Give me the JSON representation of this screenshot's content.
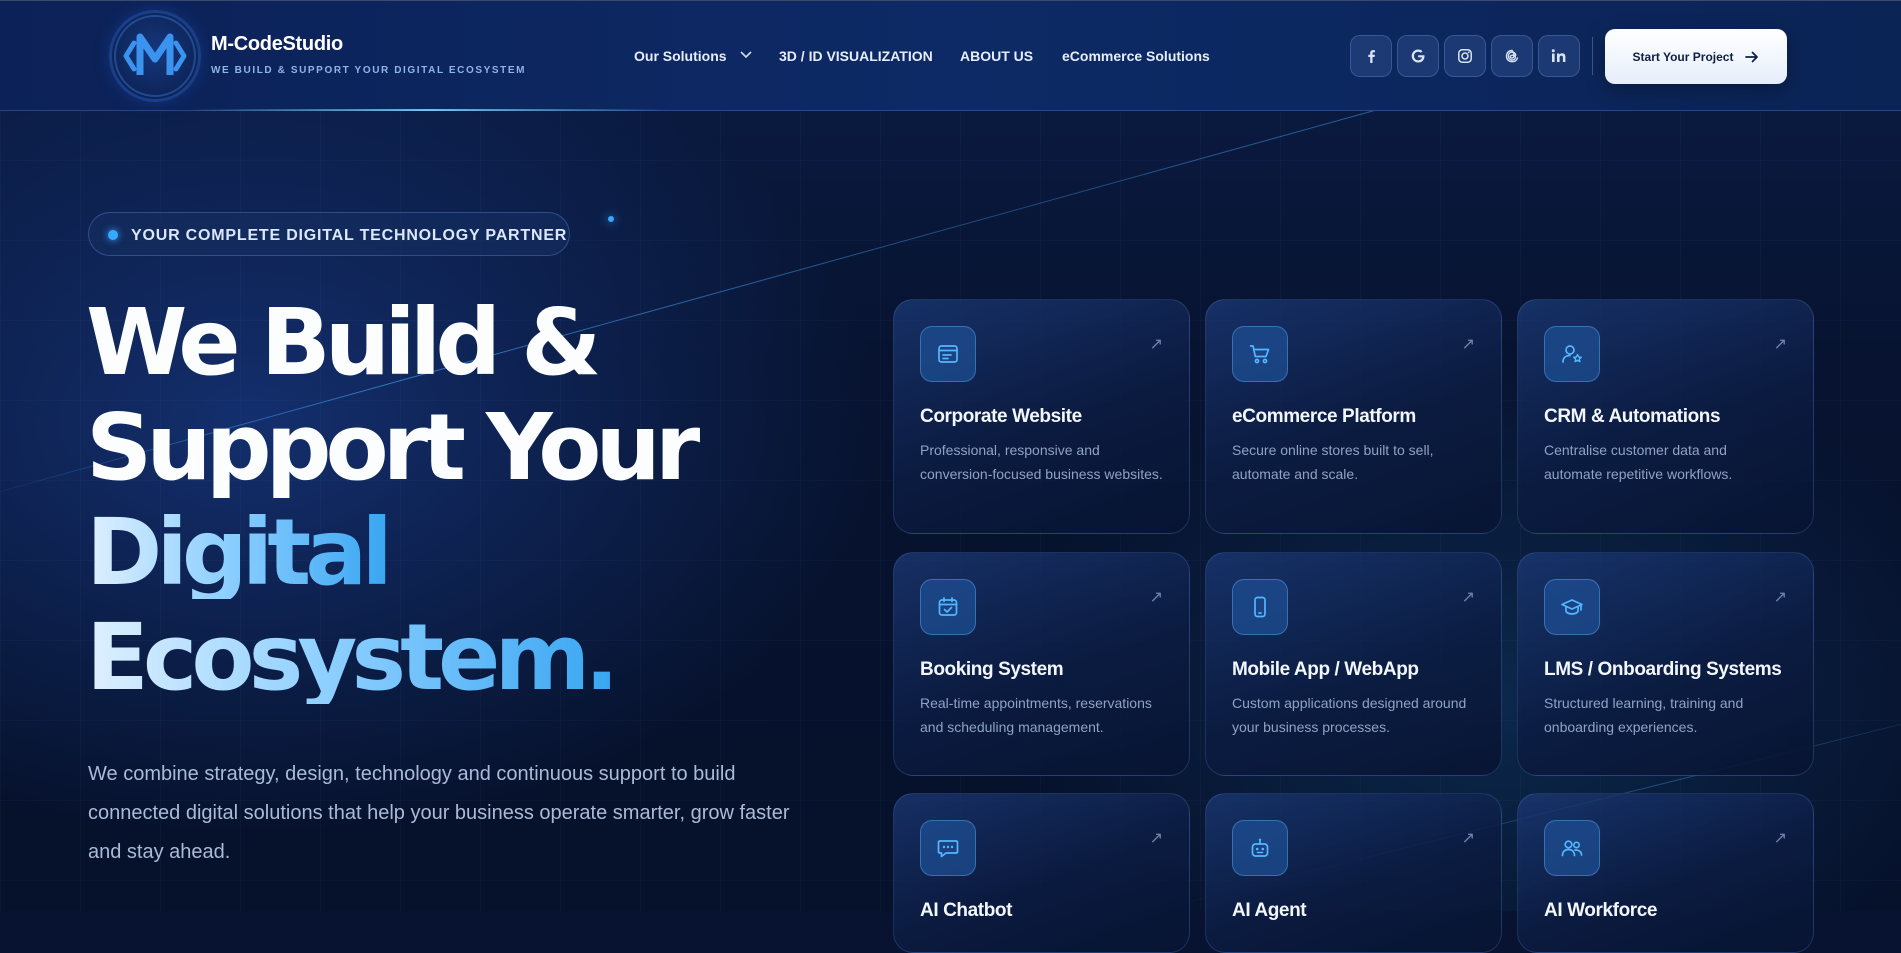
{
  "brand": {
    "name": "M-CodeStudio",
    "tagline": "WE BUILD & SUPPORT YOUR DIGITAL ECOSYSTEM"
  },
  "nav": {
    "items": [
      {
        "label": "Our Solutions",
        "has_dropdown": true
      },
      {
        "label": "3D / ID VISUALIZATION"
      },
      {
        "label": "ABOUT US"
      },
      {
        "label": "eCommerce Solutions"
      }
    ]
  },
  "social": [
    "facebook-icon",
    "google-icon",
    "instagram-icon",
    "threads-icon",
    "linkedin-icon"
  ],
  "cta": {
    "label": "Start Your Project"
  },
  "hero": {
    "badge": "YOUR COMPLETE DIGITAL TECHNOLOGY PARTNER",
    "headline": {
      "line1": "We Build &",
      "line2": "Support Your",
      "line3": "Digital",
      "line4": "Ecosystem."
    },
    "lead": "We combine strategy, design, technology and continuous support to build connected digital solutions that help your business operate smarter, grow faster and stay ahead."
  },
  "cards": [
    {
      "title": "Corporate Website",
      "desc": "Professional, responsive and conversion-focused business websites.",
      "icon": "browser-window-icon"
    },
    {
      "title": "eCommerce Platform",
      "desc": "Secure online stores built to sell, automate and scale.",
      "icon": "shopping-cart-icon"
    },
    {
      "title": "CRM & Automations",
      "desc": "Centralise customer data and automate repetitive workflows.",
      "icon": "user-star-icon"
    },
    {
      "title": "Booking System",
      "desc": "Real-time appointments, reservations and scheduling management.",
      "icon": "calendar-check-icon"
    },
    {
      "title": "Mobile App / WebApp",
      "desc": "Custom applications designed around your business processes.",
      "icon": "smartphone-icon"
    },
    {
      "title": "LMS / Onboarding Systems",
      "desc": "Structured learning, training and onboarding experiences.",
      "icon": "graduation-cap-icon"
    },
    {
      "title": "AI Chatbot",
      "desc": "",
      "icon": "chat-bubble-icon"
    },
    {
      "title": "AI Agent",
      "desc": "",
      "icon": "robot-icon"
    },
    {
      "title": "AI Workforce",
      "desc": "",
      "icon": "users-icon"
    }
  ],
  "colors": {
    "background": "#071330",
    "header": "#0c2157",
    "accent": "#39a8ff",
    "gradient_text_start": "#dff0ff",
    "gradient_text_end": "#39a6f2",
    "card_text": "#8ea3c4"
  }
}
